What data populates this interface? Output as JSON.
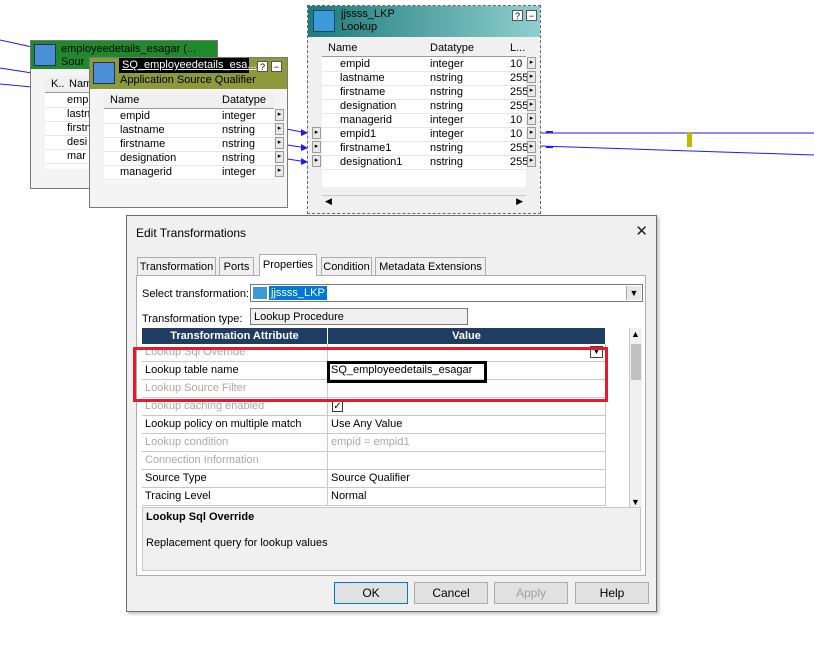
{
  "source_box": {
    "title": "employeedetails_esagar (...",
    "subtitle": "Sour",
    "header_col1": "K..",
    "header_col2": "Nam",
    "rows": [
      "emp",
      "lastn",
      "firstn",
      "desi",
      "mar"
    ]
  },
  "sq_box": {
    "title": "SQ_employeedetails_esa...",
    "subtitle": "Application Source Qualifier",
    "header_name": "Name",
    "header_datatype": "Datatype",
    "rows": [
      {
        "name": "empid",
        "datatype": "integer"
      },
      {
        "name": "lastname",
        "datatype": "nstring"
      },
      {
        "name": "firstname",
        "datatype": "nstring"
      },
      {
        "name": "designation",
        "datatype": "nstring"
      },
      {
        "name": "managerid",
        "datatype": "integer"
      }
    ]
  },
  "lkp_box": {
    "title": "jjssss_LKP",
    "subtitle": "Lookup",
    "header_name": "Name",
    "header_datatype": "Datatype",
    "header_len": "L...",
    "rows": [
      {
        "name": "empid",
        "datatype": "integer",
        "len": "10"
      },
      {
        "name": "lastname",
        "datatype": "nstring",
        "len": "255"
      },
      {
        "name": "firstname",
        "datatype": "nstring",
        "len": "255"
      },
      {
        "name": "designation",
        "datatype": "nstring",
        "len": "255"
      },
      {
        "name": "managerid",
        "datatype": "integer",
        "len": "10"
      },
      {
        "name": "empid1",
        "datatype": "integer",
        "len": "10"
      },
      {
        "name": "firstname1",
        "datatype": "nstring",
        "len": "255"
      },
      {
        "name": "designation1",
        "datatype": "nstring",
        "len": "255"
      }
    ]
  },
  "dialog": {
    "title": "Edit Transformations",
    "close": "✕",
    "tabs": [
      "Transformation",
      "Ports",
      "Properties",
      "Condition",
      "Metadata Extensions"
    ],
    "active_tab": "Properties",
    "select_label": "Select transformation:",
    "select_value": "jjssss_LKP",
    "type_label": "Transformation type:",
    "type_value": "Lookup Procedure",
    "grid_header_attr": "Transformation Attribute",
    "grid_header_value": "Value",
    "grid_rows": [
      {
        "attr": "Lookup Sql Override",
        "value": "",
        "disabled": true
      },
      {
        "attr": "Lookup table name",
        "value": "SQ_employeedetails_esagar",
        "disabled": false
      },
      {
        "attr": "Lookup Source Filter",
        "value": "",
        "disabled": true
      },
      {
        "attr": "Lookup caching enabled",
        "value": "",
        "disabled": true
      },
      {
        "attr": "Lookup policy on multiple match",
        "value": "Use Any Value",
        "disabled": false
      },
      {
        "attr": "Lookup condition",
        "value": "empid = empid1",
        "disabled": true
      },
      {
        "attr": "Connection Information",
        "value": "",
        "disabled": true
      },
      {
        "attr": "Source Type",
        "value": "Source Qualifier",
        "disabled": false
      },
      {
        "attr": "Tracing Level",
        "value": "Normal",
        "disabled": false
      }
    ],
    "desc_title": "Lookup Sql Override",
    "desc_text": "Replacement query for lookup values",
    "buttons": {
      "ok": "OK",
      "cancel": "Cancel",
      "apply": "Apply",
      "help": "Help"
    }
  },
  "colors": {
    "source_header": "#1f8a2c",
    "sq_header": "#8c9a3c",
    "lkp_header": "#2c8b8b",
    "grid_header": "#1f3d63",
    "highlight_red": "#e8192c",
    "link_blue": "#1a1aff"
  }
}
